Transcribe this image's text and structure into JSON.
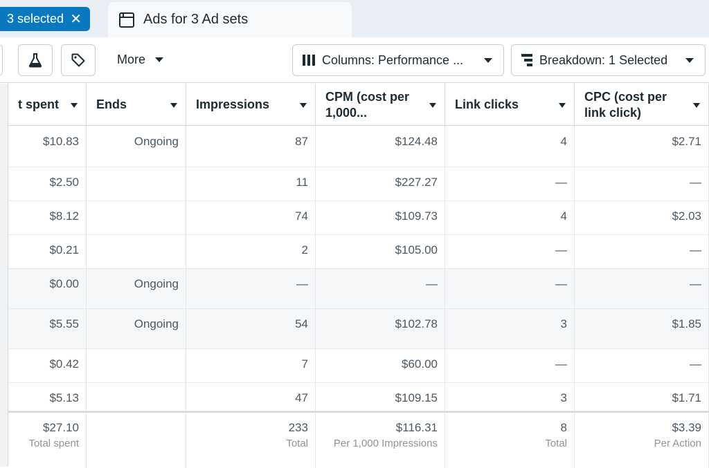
{
  "selection_chip": {
    "label": "3 selected",
    "close": "✕"
  },
  "tab": {
    "title": "Ads for 3 Ad sets"
  },
  "toolbar": {
    "more_label": "More",
    "columns_label": "Columns: Performance ...",
    "breakdown_label": "Breakdown: 1 Selected"
  },
  "columns": [
    {
      "key": "spent",
      "label": "t spent"
    },
    {
      "key": "ends",
      "label": "Ends"
    },
    {
      "key": "impressions",
      "label": "Impressions"
    },
    {
      "key": "cpm",
      "label": "CPM (cost per 1,000..."
    },
    {
      "key": "link_clicks",
      "label": "Link clicks"
    },
    {
      "key": "cpc",
      "label": "CPC (cost per link click)"
    }
  ],
  "rows": [
    {
      "spent": "$10.83",
      "ends": "Ongoing",
      "impressions": "87",
      "cpm": "$124.48",
      "link_clicks": "4",
      "cpc": "$2.71"
    },
    {
      "spent": "$2.50",
      "ends": "",
      "impressions": "11",
      "cpm": "$227.27",
      "link_clicks": "—",
      "cpc": "—"
    },
    {
      "spent": "$8.12",
      "ends": "",
      "impressions": "74",
      "cpm": "$109.73",
      "link_clicks": "4",
      "cpc": "$2.03"
    },
    {
      "spent": "$0.21",
      "ends": "",
      "impressions": "2",
      "cpm": "$105.00",
      "link_clicks": "—",
      "cpc": "—"
    },
    {
      "spent": "$0.00",
      "ends": "Ongoing",
      "impressions": "—",
      "cpm": "—",
      "link_clicks": "—",
      "cpc": "—"
    },
    {
      "spent": "$5.55",
      "ends": "Ongoing",
      "impressions": "54",
      "cpm": "$102.78",
      "link_clicks": "3",
      "cpc": "$1.85"
    },
    {
      "spent": "$0.42",
      "ends": "",
      "impressions": "7",
      "cpm": "$60.00",
      "link_clicks": "—",
      "cpc": "—"
    },
    {
      "spent": "$5.13",
      "ends": "",
      "impressions": "47",
      "cpm": "$109.15",
      "link_clicks": "3",
      "cpc": "$1.71"
    }
  ],
  "totals": {
    "spent": {
      "value": "$27.10",
      "sub": "Total spent"
    },
    "ends": {
      "value": "",
      "sub": ""
    },
    "impressions": {
      "value": "233",
      "sub": "Total"
    },
    "cpm": {
      "value": "$116.31",
      "sub": "Per 1,000 Impressions"
    },
    "link_clicks": {
      "value": "8",
      "sub": "Total"
    },
    "cpc": {
      "value": "$3.39",
      "sub": "Per Action"
    }
  },
  "colors": {
    "accent": "#0a78be",
    "header_bg": "#e9eef4"
  }
}
